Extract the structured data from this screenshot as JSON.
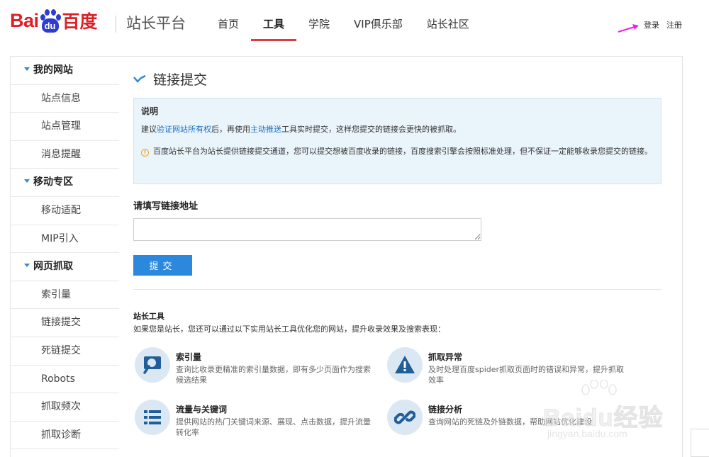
{
  "header": {
    "logo_text_left": "Bai",
    "logo_paw_text": "du",
    "logo_text_cn": "百度",
    "product_name": "站长平台",
    "nav": [
      {
        "label": "首页",
        "active": false
      },
      {
        "label": "工具",
        "active": true
      },
      {
        "label": "学院",
        "active": false
      },
      {
        "label": "VIP俱乐部",
        "active": false
      },
      {
        "label": "站长社区",
        "active": false
      }
    ],
    "login": "登录",
    "register": "注册",
    "accent_color": "#e4393c",
    "annotation_arrow_color": "#ee22dd"
  },
  "sidebar": {
    "groups": [
      {
        "label": "我的网站",
        "items": [
          "站点信息",
          "站点管理",
          "消息提醒"
        ]
      },
      {
        "label": "移动专区",
        "items": [
          "移动适配",
          "MIP引入"
        ]
      },
      {
        "label": "网页抓取",
        "items": [
          "索引量",
          "链接提交",
          "死链提交",
          "Robots",
          "抓取频次",
          "抓取诊断"
        ]
      }
    ]
  },
  "main": {
    "title": "链接提交",
    "notice": {
      "title": "说明",
      "line1_prefix": "建议",
      "line1_link1": "验证网站所有权",
      "line1_mid": "后，再使用",
      "line1_link2": "主动推送",
      "line1_suffix": "工具实时提交，这样您提交的链接会更快的被抓取。",
      "warning": "百度站长平台为站长提供链接提交通道，您可以提交想被百度收录的链接，百度搜索引擎会按照标准处理，但不保证一定能够收录您提交的链接。"
    },
    "form_label": "请填写链接地址",
    "url_value": "",
    "submit_label": "提交",
    "tools_title": "站长工具",
    "tools_desc": "如果您是站长，您还可以通过以下实用站长工具优化您的网站，提升收录效果及搜索表现：",
    "tools": [
      {
        "name": "索引量",
        "desc": "查询比收录更精准的索引量数据，即有多少页面作为搜索候选结果",
        "icon": "magnifier-icon"
      },
      {
        "name": "抓取异常",
        "desc": "及时处理百度spider抓取页面时的错误和异常，提升抓取效率",
        "icon": "warning-triangle-icon"
      },
      {
        "name": "流量与关键词",
        "desc": "提供网站的热门关键词来源、展现、点击数据，提升流量转化率",
        "icon": "list-icon"
      },
      {
        "name": "链接分析",
        "desc": "查询网站的死链及外链数据，帮助网站优化建设",
        "icon": "link-icon"
      }
    ],
    "primary_color": "#2b88dd"
  },
  "watermark": {
    "text": "Baidu经验",
    "url": "jingyan.baidu.com"
  }
}
